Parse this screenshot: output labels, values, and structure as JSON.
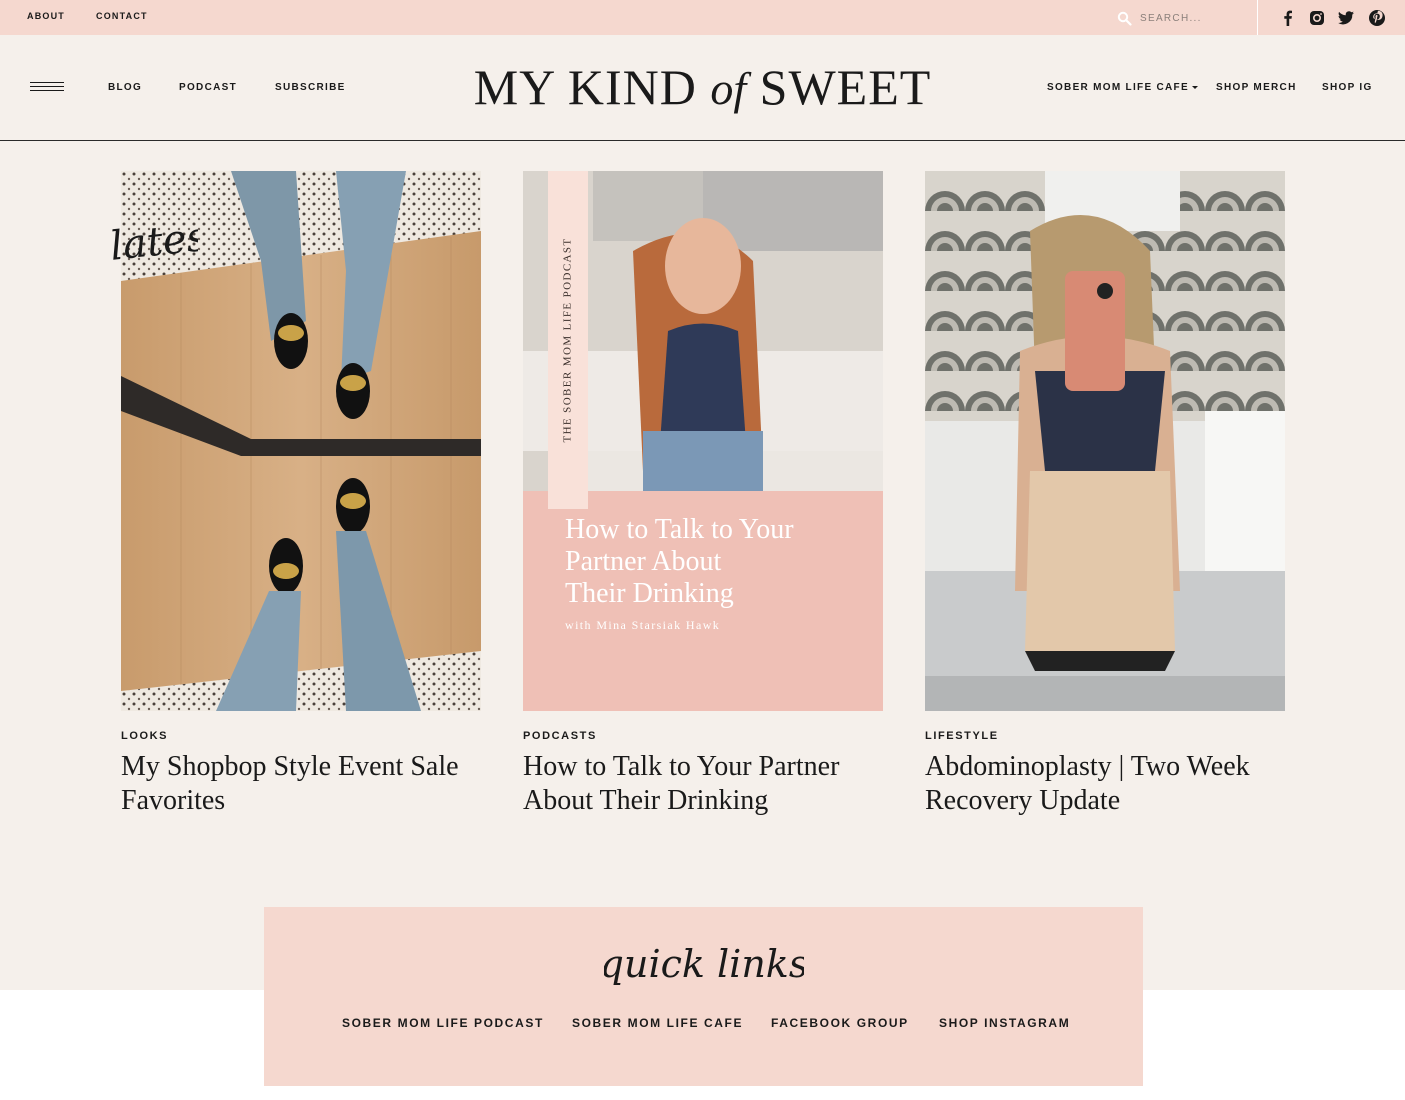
{
  "topbar": {
    "links": [
      "ABOUT",
      "CONTACT"
    ],
    "search_placeholder": "SEARCH...",
    "social_icons": [
      "facebook-icon",
      "instagram-icon",
      "twitter-icon",
      "pinterest-icon"
    ]
  },
  "header": {
    "nav_left": [
      "BLOG",
      "PODCAST",
      "SUBSCRIBE"
    ],
    "logo": {
      "part1": "MY KIND",
      "part2": "of",
      "part3": "SWEET"
    },
    "nav_right": [
      "SOBER MOM LIFE CAFE",
      "SHOP MERCH",
      "SHOP IG"
    ]
  },
  "latest_script": "latest",
  "posts": [
    {
      "category": "LOOKS",
      "title": "My Shopbop Style Event Sale Favorites"
    },
    {
      "category": "PODCASTS",
      "title": "How to Talk to Your Partner About Their Drinking",
      "image_text": {
        "vertical": "THE SOBER MOM LIFE PODCAST",
        "heading_lines": [
          "How to Talk to Your",
          "Partner About",
          "Their Drinking"
        ],
        "byline": "with Mina Starsiak Hawk"
      }
    },
    {
      "category": "LIFESTYLE",
      "title": "Abdominoplasty | Two Week Recovery Update"
    }
  ],
  "quick_links": {
    "title": "quick links",
    "links": [
      "SOBER MOM LIFE PODCAST",
      "SOBER MOM LIFE CAFE",
      "FACEBOOK GROUP",
      "SHOP INSTAGRAM"
    ]
  },
  "colors": {
    "pink": "#f5d8cf",
    "cream": "#f5f0eb",
    "podcast_pink": "#efc0b6"
  }
}
